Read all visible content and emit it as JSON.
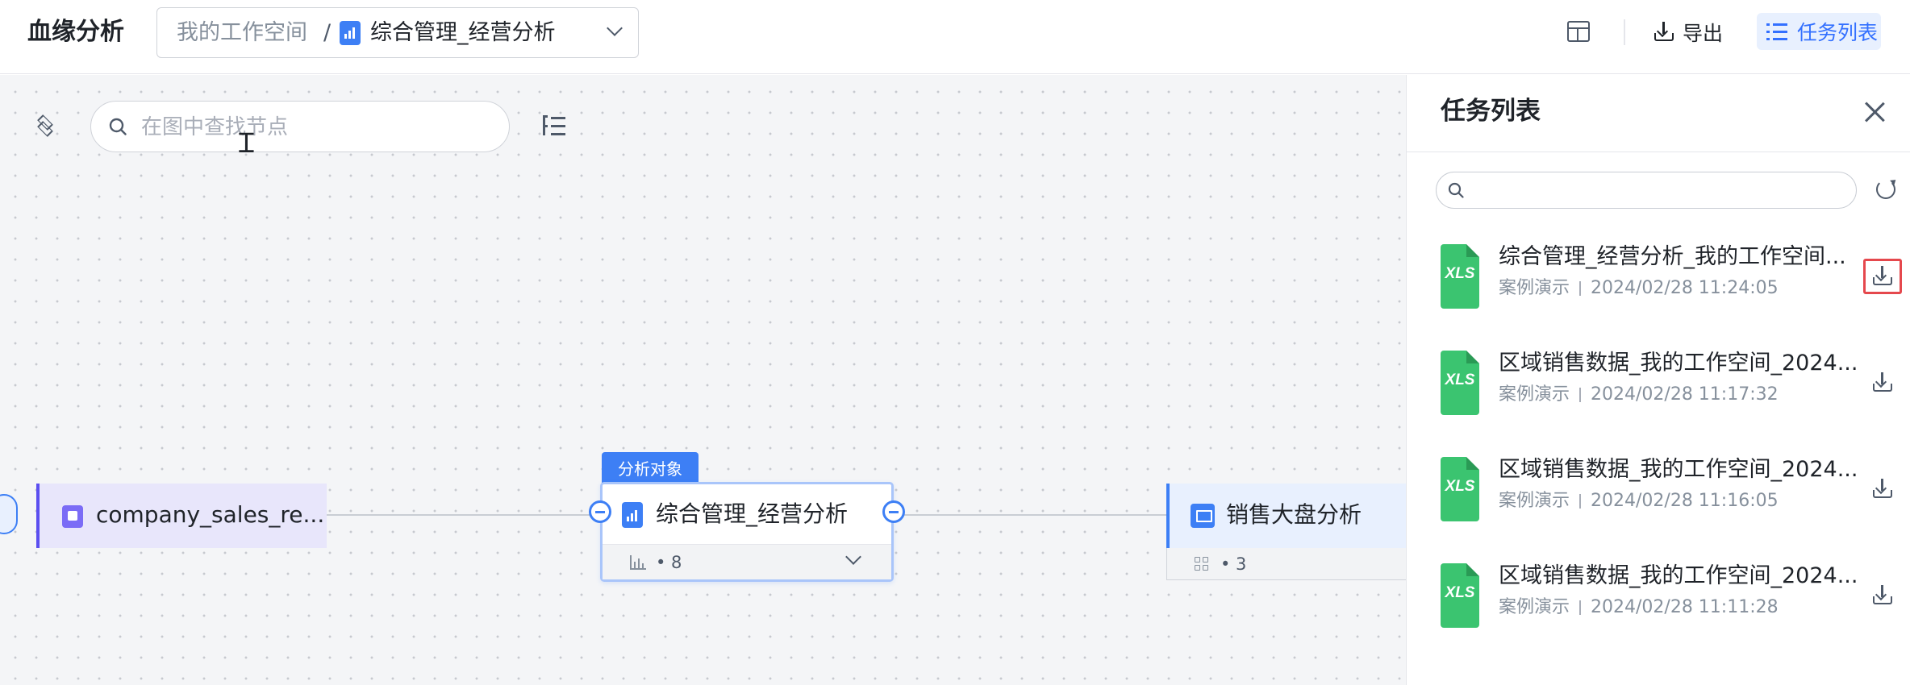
{
  "header": {
    "title": "血缘分析",
    "breadcrumb": {
      "workspace": "我的工作空间",
      "separator": "/",
      "current": "综合管理_经营分析"
    },
    "export_label": "导出",
    "tasklist_label": "任务列表"
  },
  "canvas": {
    "search_placeholder": "在图中查找节点",
    "nodes": {
      "left": {
        "label": "company_sales_re..."
      },
      "center": {
        "tag": "分析对象",
        "label": "综合管理_经营分析",
        "count": "• 8"
      },
      "right": {
        "label": "销售大盘分析",
        "count": "• 3"
      }
    }
  },
  "panel": {
    "title": "任务列表",
    "search_value": "",
    "tasks": [
      {
        "name": "综合管理_经营分析_我的工作空间...",
        "space": "案例演示",
        "time": "2024/02/28 11:24:05",
        "file_type": "XLS"
      },
      {
        "name": "区域销售数据_我的工作空间_2024...",
        "space": "案例演示",
        "time": "2024/02/28 11:17:32",
        "file_type": "XLS"
      },
      {
        "name": "区域销售数据_我的工作空间_2024...",
        "space": "案例演示",
        "time": "2024/02/28 11:16:05",
        "file_type": "XLS"
      },
      {
        "name": "区域销售数据_我的工作空间_2024...",
        "space": "案例演示",
        "time": "2024/02/28 11:11:28",
        "file_type": "XLS"
      }
    ]
  },
  "colors": {
    "accent": "#3d7ff5",
    "dataset_node": "#5b4ff0",
    "xls_green": "#3bc470",
    "highlight_red": "#e5484d"
  },
  "icons": [
    "layout-icon",
    "download-icon",
    "list-icon",
    "layers-icon",
    "search-icon",
    "tree-icon",
    "close-icon",
    "refresh-icon",
    "xls-file-icon",
    "bar-chart-icon",
    "dashboard-icon",
    "dataset-icon",
    "chevron-down-icon"
  ]
}
